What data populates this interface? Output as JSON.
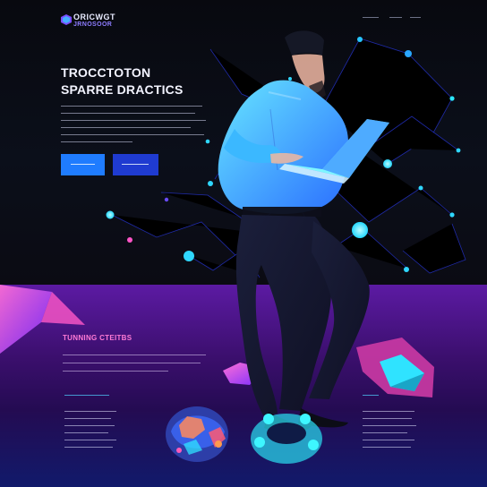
{
  "brand": {
    "name_line1": "ORICWGT",
    "name_line2": "JRNOSOOR"
  },
  "nav": {
    "items": [
      "",
      "",
      ""
    ]
  },
  "hero": {
    "title_line1": "TROCCTOTON",
    "title_line2": "SPARRE DRACTICS",
    "primary_button": "",
    "secondary_button": ""
  },
  "features": {
    "title": "TUNNING CTEITBS",
    "col1_title": "",
    "col2_title": ""
  },
  "colors": {
    "accent_cyan": "#2fe3ff",
    "accent_blue": "#1f7cff",
    "accent_magenta": "#ff7ad6",
    "purple": "#5c1aa3"
  },
  "icons": [
    "brand-logo-icon",
    "laptop-icon",
    "network-node-icon",
    "gem-icon"
  ]
}
